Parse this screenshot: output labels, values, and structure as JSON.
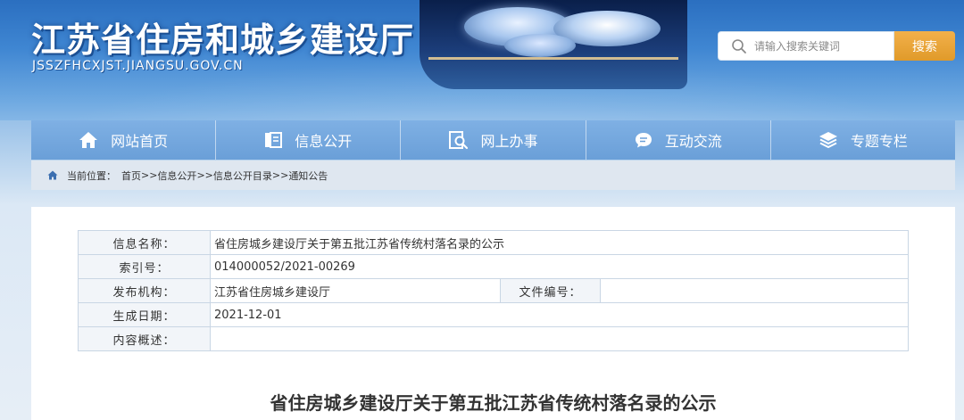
{
  "header": {
    "site_title": "江苏省住房和城乡建设厅",
    "site_domain": "JSSZFHCXJST.JIANGSU.GOV.CN"
  },
  "search": {
    "placeholder": "请输入搜索关键词",
    "button_label": "搜索"
  },
  "nav": {
    "items": [
      {
        "label": "网站首页",
        "icon": "home-icon"
      },
      {
        "label": "信息公开",
        "icon": "document-icon"
      },
      {
        "label": "网上办事",
        "icon": "search-document-icon"
      },
      {
        "label": "互动交流",
        "icon": "chat-icon"
      },
      {
        "label": "专题专栏",
        "icon": "layers-icon"
      }
    ]
  },
  "breadcrumb": {
    "prefix": "当前位置：",
    "items": [
      "首页",
      "信息公开",
      "信息公开目录",
      "通知公告"
    ],
    "separator": ">>"
  },
  "info_table": {
    "name_label": "信息名称：",
    "name_value": "省住房城乡建设厅关于第五批江苏省传统村落名录的公示",
    "index_label": "索引号：",
    "index_value": "014000052/2021-00269",
    "publisher_label": "发布机构：",
    "publisher_value": "江苏省住房城乡建设厅",
    "file_no_label": "文件编号：",
    "file_no_value": "",
    "date_label": "生成日期：",
    "date_value": "2021-12-01",
    "summary_label": "内容概述：",
    "summary_value": ""
  },
  "document": {
    "title": "省住房城乡建设厅关于第五批江苏省传统村落名录的公示"
  },
  "colors": {
    "nav_bg": "#6a9fd8",
    "search_button": "#e09a2a",
    "header_blue": "#2b6fc0"
  }
}
